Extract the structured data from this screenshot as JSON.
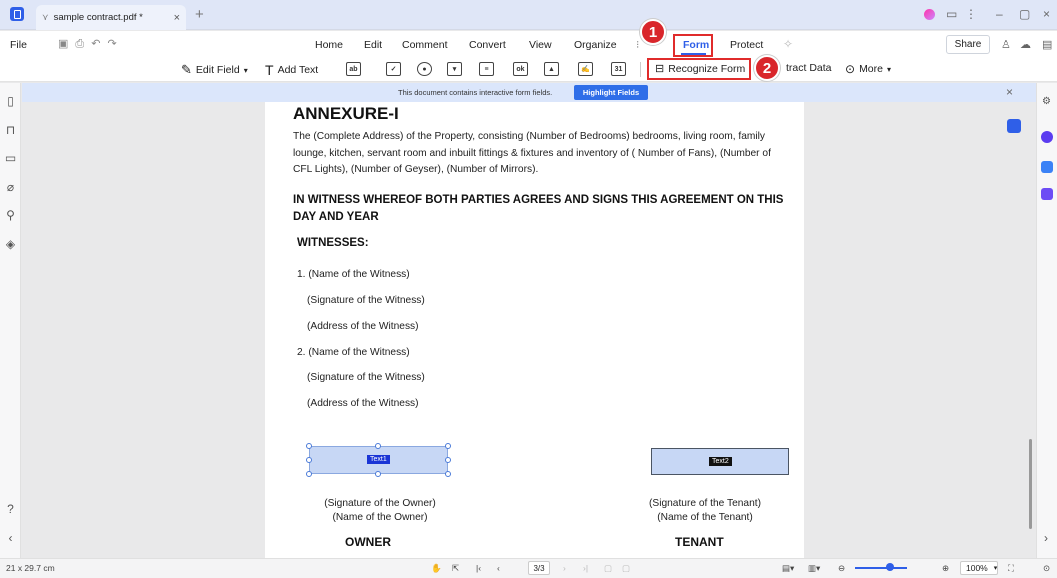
{
  "titlebar": {
    "tab_label": "sample contract.pdf *",
    "close": "×",
    "new_tab": "+",
    "win_min": "–",
    "win_max": "▢",
    "win_close": "×"
  },
  "menubar": {
    "file": "File",
    "items": [
      "Home",
      "Edit",
      "Comment",
      "Convert",
      "View",
      "Organize",
      "Form",
      "Protect"
    ],
    "active": "Form",
    "share": "Share"
  },
  "toolbar": {
    "edit_field": "Edit Field",
    "add_text": "Add Text",
    "field_icons": [
      "ab",
      "✓",
      "●",
      "▾",
      "≡",
      "ok",
      "▲",
      "✍",
      "31"
    ],
    "recognize_form": "Recognize Form",
    "extract_data": "tract Data",
    "more": "More"
  },
  "callouts": {
    "one": "1",
    "two": "2"
  },
  "notice": {
    "text": "This document contains interactive form fields.",
    "button": "Highlight Fields",
    "close": "×"
  },
  "document": {
    "heading": "ANNEXURE-I",
    "paragraph": "The (Complete Address) of the Property, consisting (Number of Bedrooms) bedrooms, living room, family lounge, kitchen, servant room and inbuilt fittings & fixtures and inventory of ( Number of Fans), (Number of CFL Lights), (Number of Geyser), (Number of Mirrors).",
    "witness_heading": "IN WITNESS WHEREOF BOTH PARTIES AGREES AND SIGNS THIS AGREEMENT ON THIS DAY AND YEAR",
    "witnesses_label": "WITNESSES:",
    "witness_lines": [
      "1. (Name of the Witness)",
      "(Signature of the Witness)",
      "(Address of the Witness)",
      "2. (Name of the Witness)",
      "(Signature of the Witness)",
      "(Address of the Witness)"
    ],
    "field1_label": "Text1",
    "field2_label": "Text2",
    "owner_sig": "(Signature of the Owner)",
    "owner_name": "(Name of the Owner)",
    "owner_role": "OWNER",
    "tenant_sig": "(Signature of the Tenant)",
    "tenant_name": "(Name of the Tenant)",
    "tenant_role": "TENANT"
  },
  "statusbar": {
    "page_size": "21 x 29.7 cm",
    "page_indicator": "3/3",
    "zoom": "100%"
  },
  "colors": {
    "accent": "#2f5fe8",
    "callout": "#d9262b",
    "notice_bg": "#dbe6fb"
  }
}
